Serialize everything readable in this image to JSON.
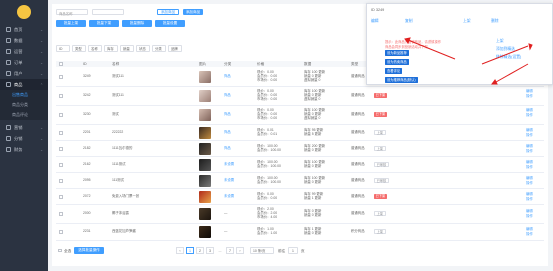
{
  "sidebar": {
    "items": [
      {
        "label": "首页",
        "icon": "home-icon"
      },
      {
        "label": "数据",
        "icon": "chart-icon"
      },
      {
        "label": "运营",
        "icon": "operation-icon"
      },
      {
        "label": "订单",
        "icon": "order-icon"
      },
      {
        "label": "用户",
        "icon": "user-icon"
      },
      {
        "label": "商品",
        "icon": "goods-icon"
      },
      {
        "label": "营销",
        "icon": "marketing-icon"
      },
      {
        "label": "分销",
        "icon": "distribution-icon"
      },
      {
        "label": "财务",
        "icon": "finance-icon"
      }
    ],
    "sub_items": [
      {
        "label": "出售商品"
      },
      {
        "label": "商品分类"
      },
      {
        "label": "商品评论"
      }
    ]
  },
  "toolbar": {
    "search_placeholder": "商品名称",
    "search_button": "添加商品",
    "add_button": "添加商品",
    "batch_buttons": [
      "批量上架",
      "批量下架",
      "批量删除",
      "批量设置"
    ],
    "filters": [
      "ID",
      "类型",
      "名称",
      "库存",
      "销量",
      "状态",
      "分类",
      "品牌"
    ]
  },
  "table": {
    "headers": [
      "ID",
      "名称",
      "图片",
      "分类",
      "价格",
      "数据",
      "类型",
      "状态",
      "操作"
    ],
    "rows": [
      {
        "id": "3249",
        "name": "测试111",
        "category": "饰品",
        "price": "现价：0.00\n会员价：0.00\n市场价：0.00",
        "data": "库存 100 更新\n销量 0 更新\n虚拟销量 0",
        "type": "普通商品",
        "status": "已下架",
        "status_kind": "red",
        "ops": "编辑\n操作"
      },
      {
        "id": "3242",
        "name": "测试111",
        "category": "饰品",
        "price": "现价：0.00\n会员价：0.00\n市场价：0.00",
        "data": "库存 100 更新\n销量 0 更新\n虚拟销量 0",
        "type": "普通商品",
        "status": "已下架",
        "status_kind": "red",
        "ops": "编辑\n操作"
      },
      {
        "id": "3230",
        "name": "测试",
        "category": "饰品",
        "price": "现价：0.00\n会员价：0.00\n市场价：0.00",
        "data": "库存 100 更新\n销量 0 更新\n虚拟销量 0",
        "type": "普通商品",
        "status": "已下架",
        "status_kind": "red",
        "ops": "编辑\n操作"
      },
      {
        "id": "2201",
        "name": "222222",
        "category": "饰品",
        "price": "现价：0.01\n会员价：0.01",
        "data": "库存 95 更新\n销量 5 更新",
        "type": "普通商品",
        "status": "上架",
        "status_kind": "grey",
        "ops": "编辑\n操作"
      },
      {
        "id": "2182",
        "name": "1111瓦尔德的",
        "category": "饰品",
        "price": "现价：100.00\n会员价：100.00",
        "data": "库存 200 更新\n销量 0 更新",
        "type": "普通商品",
        "status": "上架",
        "status_kind": "grey",
        "ops": "编辑\n操作"
      },
      {
        "id": "2162",
        "name": "1111测试",
        "category": "未设置",
        "price": "现价：100.00\n会员价：100.00",
        "data": "库存 100 更新\n销量 0 更新",
        "type": "普通商品",
        "status": "已审核",
        "status_kind": "grey",
        "ops": "编辑\n操作"
      },
      {
        "id": "2095",
        "name": "111测试",
        "category": "未设置",
        "price": "现价：100.00\n会员价：100.00",
        "data": "库存 100 更新\n销量 0 更新",
        "type": "普通商品",
        "status": "已审核",
        "status_kind": "grey",
        "ops": "编辑\n操作"
      },
      {
        "id": "2072",
        "name": "免费入场门票一张",
        "category": "未设置",
        "price": "现价：0.00\n会员价：0.00",
        "data": "库存 99 更新\n销量 1 更新",
        "type": "普通商品",
        "status": "已下架",
        "status_kind": "red",
        "ops": "编辑\n操作"
      },
      {
        "id": "2000",
        "name": "椰子沐浴露",
        "category": "—",
        "price": "现价：2.00\n会员价：2.00\n市场价：4.00",
        "data": "库存 0 更新\n销量 0 更新",
        "type": "普通商品",
        "status": "上架",
        "status_kind": "grey",
        "ops": "编辑\n操作"
      },
      {
        "id": "2231",
        "name": "西蓝花加芦笋酱",
        "category": "—",
        "price": "现价：1.00\n会员价：1.00",
        "data": "库存 1 更新\n销量 0 更新",
        "type": "积分商品",
        "status": "上架",
        "status_kind": "grey",
        "ops": "编辑\n操作"
      }
    ]
  },
  "footer": {
    "select_all": "全选",
    "batch_select": "选择批量操作",
    "pages": [
      "1",
      "2",
      "3",
      "...",
      "7"
    ],
    "page_size": "10 条/页",
    "goto_label": "前往",
    "goto_value": "1",
    "page_suffix": "页"
  },
  "popup": {
    "id_label": "ID 3249",
    "tabs": [
      "编辑",
      "复制",
      "上架",
      "删除"
    ],
    "warning": "提示：此商品为营销商品，请谨慎操作",
    "warning2": "商品会同步到营销活动并下架",
    "menu": [
      "设为新品推荐",
      "设为热卖商品",
      "查看评论",
      "设为推荐商品(默认)"
    ],
    "side_links": [
      "上架",
      "添加到精选",
      "移除精选(设置)"
    ]
  },
  "colors": {
    "accent": "#409eff",
    "sidebar": "#2b3341",
    "danger": "#f56c6c",
    "annotation_arrow": "#e02020"
  }
}
